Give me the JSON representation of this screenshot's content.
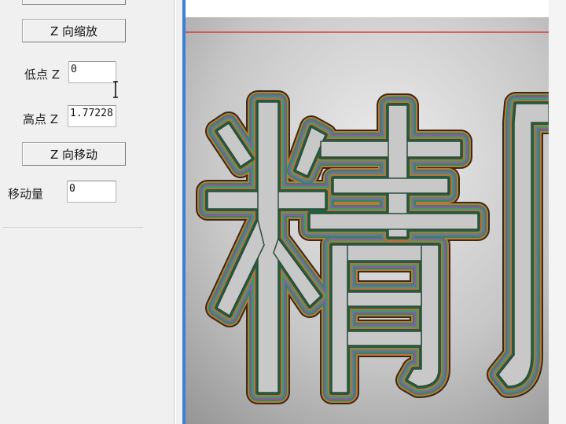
{
  "panel": {
    "z_zoom_button": "Z 向缩放",
    "low_z_label": "低点 Z",
    "low_z_value": "0",
    "high_z_label": "高点 Z",
    "high_z_value": "1.77228",
    "z_move_button": "Z 向移动",
    "move_amount_label": "移动量",
    "move_amount_value": "0"
  },
  "viewport": {
    "relief_text": "精",
    "colors": {
      "red_line": "#e02020",
      "background": "#c2c2c2",
      "edge_green": "#2f8a5a",
      "edge_orange": "#c0753a"
    }
  }
}
